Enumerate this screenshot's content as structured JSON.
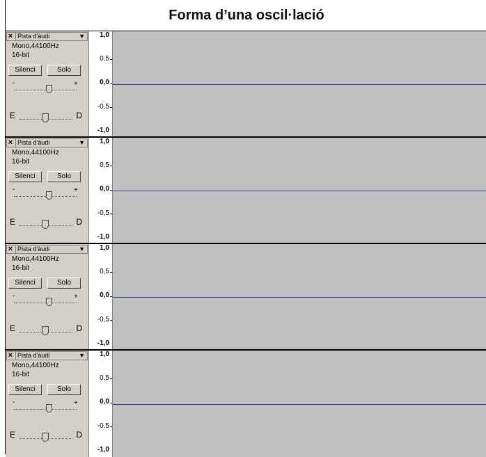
{
  "page": {
    "title": "Forma d’una oscil·lació"
  },
  "track_controls": {
    "close_label": "×",
    "name": "Pista d'àudi",
    "dropdown_label": "▼",
    "format": "Mono,44100Hz",
    "bit_depth": "16-bit",
    "mute_label": "Silenci",
    "solo_label": "Solo",
    "gain_minus": "-",
    "gain_plus": "+",
    "pan_left": "E",
    "pan_right": "D"
  },
  "ruler": {
    "top": "1,0",
    "upper": "0,5",
    "middle": "0,0",
    "lower": "-0,5",
    "bottom": "-1,0"
  },
  "tracks": [
    {
      "id": 1,
      "waveform": "silent"
    },
    {
      "id": 2,
      "waveform": "silent"
    },
    {
      "id": 3,
      "waveform": "silent"
    },
    {
      "id": 4,
      "waveform": "silent"
    }
  ],
  "colors": {
    "waveform_line": "#2f3fa8",
    "wave_bg": "#c0c0c0",
    "panel_bg": "#d4d0c8"
  }
}
